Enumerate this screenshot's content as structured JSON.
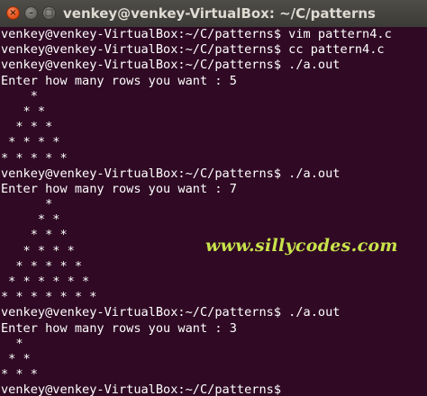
{
  "window": {
    "title": "venkey@venkey-VirtualBox: ~/C/patterns",
    "close_glyph": "×",
    "minimize_glyph": "–",
    "maximize_glyph": "□"
  },
  "terminal": {
    "lines": [
      "venkey@venkey-VirtualBox:~/C/patterns$ vim pattern4.c",
      "venkey@venkey-VirtualBox:~/C/patterns$ cc pattern4.c",
      "venkey@venkey-VirtualBox:~/C/patterns$ ./a.out",
      "Enter how many rows you want : 5",
      "    *",
      "   * *",
      "  * * *",
      " * * * *",
      "* * * * *",
      "venkey@venkey-VirtualBox:~/C/patterns$ ./a.out",
      "Enter how many rows you want : 7",
      "      *",
      "     * *",
      "    * * *",
      "   * * * *",
      "  * * * * *",
      " * * * * * *",
      "* * * * * * *",
      "venkey@venkey-VirtualBox:~/C/patterns$ ./a.out",
      "Enter how many rows you want : 3",
      "  *",
      " * *",
      "* * *",
      "venkey@venkey-VirtualBox:~/C/patterns$"
    ]
  },
  "watermark": {
    "text": "www.sillycodes.com"
  },
  "colors": {
    "terminal_background": "#300a24",
    "terminal_text": "#ffffff",
    "titlebar": "#3c3b37",
    "close_button": "#e9561f",
    "watermark": "#c8e34b"
  }
}
